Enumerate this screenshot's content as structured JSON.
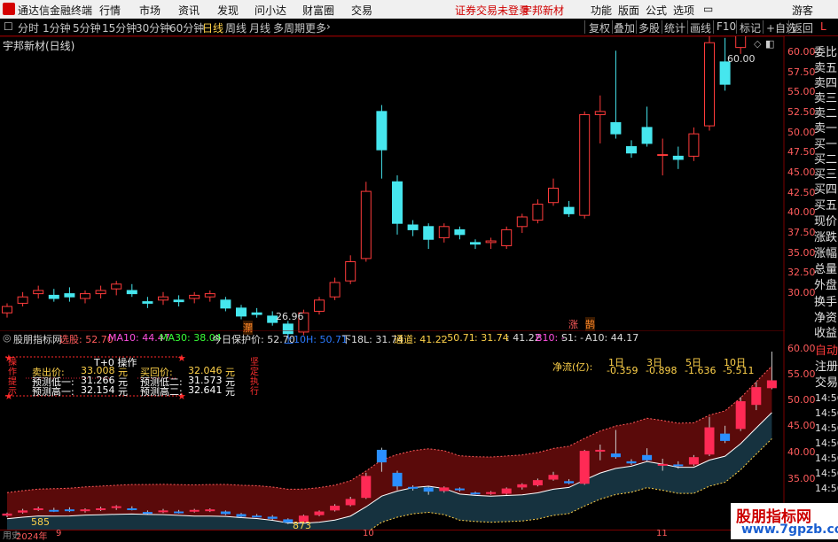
{
  "app": {
    "title": "通达信金融终端"
  },
  "menu": {
    "items": [
      "行情",
      "市场",
      "资讯",
      "发现",
      "问小达",
      "财富圈",
      "交易"
    ],
    "notice": "证券交易未登录",
    "stock": "宇邦新材",
    "right": [
      "功能",
      "版面",
      "公式",
      "选项"
    ],
    "guest": "游客"
  },
  "toolbar": {
    "periods": [
      "分时",
      "1分钟",
      "5分钟",
      "15分钟",
      "30分钟",
      "60分钟",
      "日线",
      "周线",
      "月线",
      "多周期",
      "更多"
    ],
    "selected": "日线",
    "actions": [
      "复权",
      "叠加",
      "多股",
      "统计",
      "画线",
      "F10",
      "标记",
      "+自选"
    ],
    "back_label": "返回"
  },
  "right_panel": {
    "tabs_top": [
      "委比",
      "卖五",
      "卖四",
      "卖三",
      "卖二",
      "卖一",
      "买一",
      "买二",
      "买三",
      "买四",
      "买五",
      "现价",
      "涨跌",
      "涨幅",
      "总量",
      "外盘",
      "换手",
      "净资",
      "收益"
    ],
    "tabs_bottom": [
      "自动",
      "注册",
      "交易"
    ],
    "extra_l": "L"
  },
  "main_chart": {
    "title": "宇邦新材(日线)",
    "max_label": "60.00",
    "min_label": "26.96",
    "y_ticks": [
      "60.00",
      "57.50",
      "55.00",
      "52.50",
      "50.00",
      "47.50",
      "45.00",
      "42.50",
      "40.00",
      "37.50",
      "35.00",
      "32.50",
      "30.00"
    ],
    "marker_1": "瀾",
    "marker_2": "涨",
    "marker_3": "鹄"
  },
  "indicator": {
    "name": "股朋指标网",
    "line_parts": [
      "选股: 52.70",
      "MA10: 44.47",
      "MA30: 38.04",
      "今日保护价: 52.70",
      "上10H: 50.71",
      "下18L: 31.74",
      "通道: 41.22",
      ": 50.71",
      ": 31.74",
      ": 41.22",
      "B10: -",
      "S1: -",
      "A10: 44.17"
    ],
    "box_title": "T+0 操作",
    "left_vertical": "操作提示",
    "right_vertical": "坚定执行",
    "rows": [
      {
        "l1": "卖出价:",
        "v1": "33.008",
        "u1": "元",
        "l2": "买回价:",
        "v2": "32.046",
        "u2": "元"
      },
      {
        "l1": "预测低一:",
        "v1": "31.266",
        "u1": "元",
        "l2": "预测低二:",
        "v2": "31.573",
        "u2": "元"
      },
      {
        "l1": "预测高一:",
        "v1": "32.154",
        "u1": "元",
        "l2": "预测高二:",
        "v2": "32.641",
        "u2": "元"
      }
    ],
    "netflow_label": "净流(亿):",
    "netflow_headers": [
      "1日",
      "3日",
      "5日",
      "10日"
    ],
    "netflow_values": [
      "-0.359",
      "-0.898",
      "-1.636",
      "-5.511"
    ],
    "y_ticks": [
      "60.00",
      "55.00",
      "50.00",
      "45.00",
      "40.00",
      "35.00"
    ],
    "right_times": [
      "14:56",
      "14:56",
      "14:56",
      "14:56",
      "14:56",
      "14:56",
      "14:56",
      "14:56"
    ],
    "low_label_1": "585",
    "low_label_2": "873"
  },
  "x_axis": {
    "labels": [
      "2024年",
      "9",
      "10",
      "11"
    ],
    "footer_left": "用史"
  },
  "watermark": {
    "line1": "股朋指标网",
    "line2": "www.7gpzb.com"
  },
  "chart_data": {
    "type": "candlestick",
    "title": "宇邦新材(日线)",
    "ylim": [
      26,
      61
    ],
    "candles": [
      {
        "o": 28.6,
        "h": 29.2,
        "l": 28.3,
        "c": 29.0
      },
      {
        "o": 29.2,
        "h": 29.9,
        "l": 29.0,
        "c": 29.6
      },
      {
        "o": 29.8,
        "h": 30.3,
        "l": 29.5,
        "c": 30.0
      },
      {
        "o": 29.7,
        "h": 30.1,
        "l": 29.3,
        "c": 29.5
      },
      {
        "o": 29.8,
        "h": 30.2,
        "l": 29.3,
        "c": 29.6
      },
      {
        "o": 29.5,
        "h": 30.0,
        "l": 29.2,
        "c": 29.8
      },
      {
        "o": 29.8,
        "h": 30.3,
        "l": 29.5,
        "c": 30.0
      },
      {
        "o": 30.1,
        "h": 30.6,
        "l": 29.7,
        "c": 30.4
      },
      {
        "o": 30.0,
        "h": 30.4,
        "l": 29.6,
        "c": 29.8
      },
      {
        "o": 29.3,
        "h": 29.6,
        "l": 28.9,
        "c": 29.2
      },
      {
        "o": 29.4,
        "h": 29.9,
        "l": 29.1,
        "c": 29.6
      },
      {
        "o": 29.4,
        "h": 29.7,
        "l": 29.0,
        "c": 29.3
      },
      {
        "o": 29.5,
        "h": 29.9,
        "l": 29.2,
        "c": 29.7
      },
      {
        "o": 29.6,
        "h": 30.0,
        "l": 29.3,
        "c": 29.8
      },
      {
        "o": 29.4,
        "h": 29.6,
        "l": 28.7,
        "c": 28.9
      },
      {
        "o": 28.9,
        "h": 29.1,
        "l": 28.2,
        "c": 28.4
      },
      {
        "o": 28.6,
        "h": 28.9,
        "l": 28.3,
        "c": 28.5
      },
      {
        "o": 28.4,
        "h": 28.7,
        "l": 27.8,
        "c": 28.0
      },
      {
        "o": 27.9,
        "h": 28.1,
        "l": 27.0,
        "c": 27.3
      },
      {
        "o": 27.4,
        "h": 28.8,
        "l": 27.2,
        "c": 28.6
      },
      {
        "o": 28.7,
        "h": 29.6,
        "l": 28.5,
        "c": 29.4
      },
      {
        "o": 29.6,
        "h": 30.8,
        "l": 29.4,
        "c": 30.5
      },
      {
        "o": 30.6,
        "h": 32.2,
        "l": 30.4,
        "c": 31.8
      },
      {
        "o": 32.0,
        "h": 36.8,
        "l": 31.8,
        "c": 36.2
      },
      {
        "o": 41.2,
        "h": 41.6,
        "l": 37.0,
        "c": 38.8
      },
      {
        "o": 36.8,
        "h": 37.2,
        "l": 33.5,
        "c": 34.2
      },
      {
        "o": 34.1,
        "h": 34.4,
        "l": 33.4,
        "c": 33.8
      },
      {
        "o": 34.0,
        "h": 34.2,
        "l": 32.6,
        "c": 33.2
      },
      {
        "o": 33.3,
        "h": 34.2,
        "l": 33.0,
        "c": 34.0
      },
      {
        "o": 33.8,
        "h": 34.0,
        "l": 33.2,
        "c": 33.5
      },
      {
        "o": 33.0,
        "h": 33.2,
        "l": 32.6,
        "c": 32.9
      },
      {
        "o": 33.0,
        "h": 33.3,
        "l": 32.6,
        "c": 33.1
      },
      {
        "o": 32.8,
        "h": 34.0,
        "l": 32.6,
        "c": 33.8
      },
      {
        "o": 34.0,
        "h": 34.8,
        "l": 33.6,
        "c": 34.6
      },
      {
        "o": 34.4,
        "h": 35.7,
        "l": 34.2,
        "c": 35.4
      },
      {
        "o": 35.5,
        "h": 37.0,
        "l": 35.3,
        "c": 36.4
      },
      {
        "o": 35.2,
        "h": 35.6,
        "l": 34.6,
        "c": 34.8
      },
      {
        "o": 34.7,
        "h": 41.2,
        "l": 34.5,
        "c": 41.0
      },
      {
        "o": 41.0,
        "h": 42.2,
        "l": 39.2,
        "c": 41.2
      },
      {
        "o": 40.5,
        "h": 45.0,
        "l": 39.5,
        "c": 39.8
      },
      {
        "o": 39.0,
        "h": 39.4,
        "l": 38.3,
        "c": 38.6
      },
      {
        "o": 40.2,
        "h": 41.5,
        "l": 39.0,
        "c": 39.2
      },
      {
        "o": 38.5,
        "h": 39.5,
        "l": 37.2,
        "c": 38.5
      },
      {
        "o": 38.4,
        "h": 39.0,
        "l": 37.6,
        "c": 38.2
      },
      {
        "o": 38.4,
        "h": 40.2,
        "l": 38.1,
        "c": 39.8
      },
      {
        "o": 40.3,
        "h": 47.5,
        "l": 40.0,
        "c": 45.5
      },
      {
        "o": 44.3,
        "h": 45.8,
        "l": 42.5,
        "c": 42.9
      },
      {
        "o": 45.2,
        "h": 51.3,
        "l": 44.8,
        "c": 50.5
      },
      {
        "o": 49.8,
        "h": 54.2,
        "l": 48.8,
        "c": 53.2
      },
      {
        "o": 53.0,
        "h": 60.0,
        "l": 52.8,
        "c": 54.5
      }
    ]
  }
}
